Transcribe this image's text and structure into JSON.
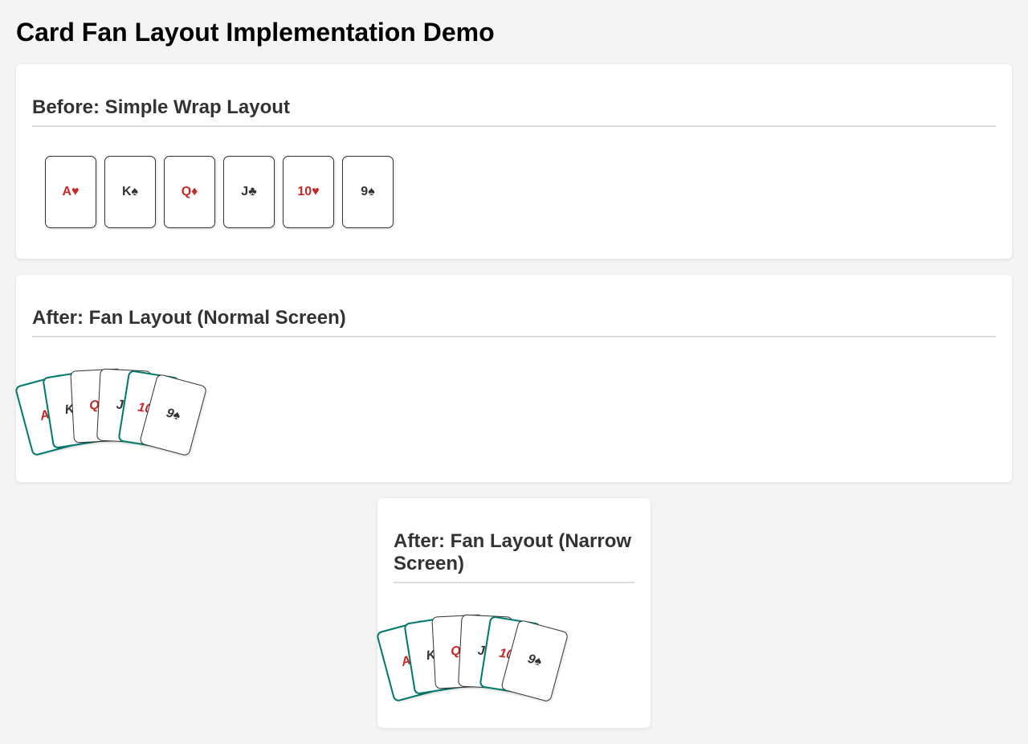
{
  "page": {
    "title": "Card Fan Layout Implementation Demo"
  },
  "sections": {
    "before": {
      "heading": "Before: Simple Wrap Layout",
      "cards": [
        {
          "label": "A♥",
          "color": "red"
        },
        {
          "label": "K♠",
          "color": "black"
        },
        {
          "label": "Q♦",
          "color": "red"
        },
        {
          "label": "J♣",
          "color": "black"
        },
        {
          "label": "10♥",
          "color": "red"
        },
        {
          "label": "9♠",
          "color": "black"
        }
      ]
    },
    "fan_normal": {
      "heading": "After: Fan Layout (Normal Screen)",
      "cards": [
        {
          "label": "A♥",
          "color": "red",
          "border": "teal"
        },
        {
          "label": "K♠",
          "color": "black",
          "border": "teal"
        },
        {
          "label": "Q♦",
          "color": "red",
          "border": "plain"
        },
        {
          "label": "J♣",
          "color": "black",
          "border": "plain"
        },
        {
          "label": "10♥",
          "color": "red",
          "border": "teal"
        },
        {
          "label": "9♠",
          "color": "black",
          "border": "plain"
        }
      ]
    },
    "fan_narrow": {
      "heading": "After: Fan Layout (Narrow Screen)",
      "cards": [
        {
          "label": "A♥",
          "color": "red",
          "border": "teal"
        },
        {
          "label": "K♠",
          "color": "black",
          "border": "teal"
        },
        {
          "label": "Q♦",
          "color": "red",
          "border": "plain"
        },
        {
          "label": "J♣",
          "color": "black",
          "border": "plain"
        },
        {
          "label": "10♥",
          "color": "red",
          "border": "teal"
        },
        {
          "label": "9♠",
          "color": "black",
          "border": "plain"
        }
      ]
    }
  },
  "colors": {
    "red": "#c62828",
    "black": "#333333",
    "teal": "#00796b",
    "background": "#f4f4f4",
    "panel": "#ffffff"
  }
}
